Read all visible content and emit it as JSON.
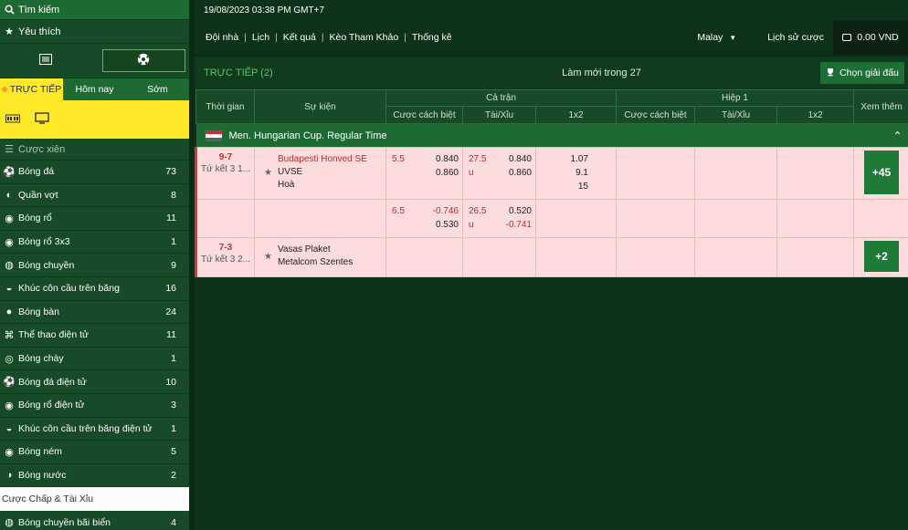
{
  "sidebar": {
    "search_label": "Tìm kiếm",
    "favorites_label": "Yêu thích",
    "tabs": [
      {
        "label": "TRỰC TIẾP",
        "active": true
      },
      {
        "label": "Hôm nay",
        "active": false
      },
      {
        "label": "Sớm",
        "active": false
      }
    ],
    "parlay_label": "Cược xiên",
    "sports": [
      {
        "name": "Bóng đá",
        "count": "73",
        "icon": "soccer-ball-icon"
      },
      {
        "name": "Quần vợt",
        "count": "8",
        "icon": "tennis-ball-icon"
      },
      {
        "name": "Bóng rổ",
        "count": "11",
        "icon": "basketball-icon"
      },
      {
        "name": "Bóng rổ 3x3",
        "count": "1",
        "icon": "basketball-icon"
      },
      {
        "name": "Bóng chuyền",
        "count": "9",
        "icon": "volleyball-icon"
      },
      {
        "name": "Khúc côn cầu trên băng",
        "count": "16",
        "icon": "ice-hockey-icon"
      },
      {
        "name": "Bóng bàn",
        "count": "24",
        "icon": "table-tennis-icon"
      },
      {
        "name": "Thể thao điện tử",
        "count": "11",
        "icon": "gamepad-icon"
      },
      {
        "name": "Bóng chày",
        "count": "1",
        "icon": "baseball-icon"
      },
      {
        "name": "Bóng đá điện tử",
        "count": "10",
        "icon": "soccer-ball-icon"
      },
      {
        "name": "Bóng rổ điện tử",
        "count": "3",
        "icon": "basketball-icon"
      },
      {
        "name": "Khúc côn cầu trên băng điện tử",
        "count": "1",
        "icon": "ice-hockey-icon"
      },
      {
        "name": "Bóng ném",
        "count": "5",
        "icon": "handball-icon"
      },
      {
        "name": "Bóng nước",
        "count": "2",
        "icon": "water-polo-icon"
      }
    ],
    "handicap_label": "Cược Chấp & Tài Xỉu",
    "beach_volley": {
      "name": "Bóng chuyền bãi biển",
      "count": "4",
      "icon": "volleyball-icon"
    }
  },
  "topbar": {
    "datetime": "19/08/2023 03:38 PM GMT+7"
  },
  "nav": {
    "items": [
      "Đội nhà",
      "Lịch",
      "Kết quả",
      "Kèo Tham Khảo",
      "Thống kê"
    ],
    "language": "Malay",
    "history": "Lịch sử cược",
    "balance": "0.00 VND"
  },
  "panel": {
    "live_title": "TRỰC TIẾP (2)",
    "refresh": "Làm mới trong 27",
    "choose_league": "Chọn giải đấu"
  },
  "table": {
    "col_time": "Thời gian",
    "col_event": "Sự kiện",
    "full_match": "Cả trận",
    "first_half": "Hiệp 1",
    "handicap": "Cược cách biệt",
    "over_under": "Tài/Xỉu",
    "one_x_two": "1x2",
    "more": "Xem thêm"
  },
  "league": {
    "name": "Men. Hungarian Cup. Regular Time",
    "flag_colors": [
      "#cd2a3e",
      "#ffffff",
      "#436f4d"
    ]
  },
  "matches": [
    {
      "score": "9-7",
      "phase": "Tứ kết 3 1...",
      "home": "Budapesti Honved SE",
      "away": "UVSE",
      "draw": "Hoà",
      "hdp": "5.5",
      "hdp_home": "0.840",
      "hdp_away": "0.860",
      "ou_line": "27.5",
      "ou_u": "u",
      "ou_over": "0.840",
      "ou_under": "0.860",
      "x1": "1.07",
      "x2": "9.1",
      "xd": "15",
      "more": "+45"
    },
    {
      "hdp": "6.5",
      "hdp_home": "-0.746",
      "hdp_away": "0.530",
      "ou_line": "26.5",
      "ou_u": "u",
      "ou_over": "0.520",
      "ou_under": "-0.741"
    },
    {
      "score": "7-3",
      "phase": "Tứ kết 3 2...",
      "home": "Vasas Plaket",
      "away": "Metalcom Szentes",
      "more": "+2"
    }
  ]
}
